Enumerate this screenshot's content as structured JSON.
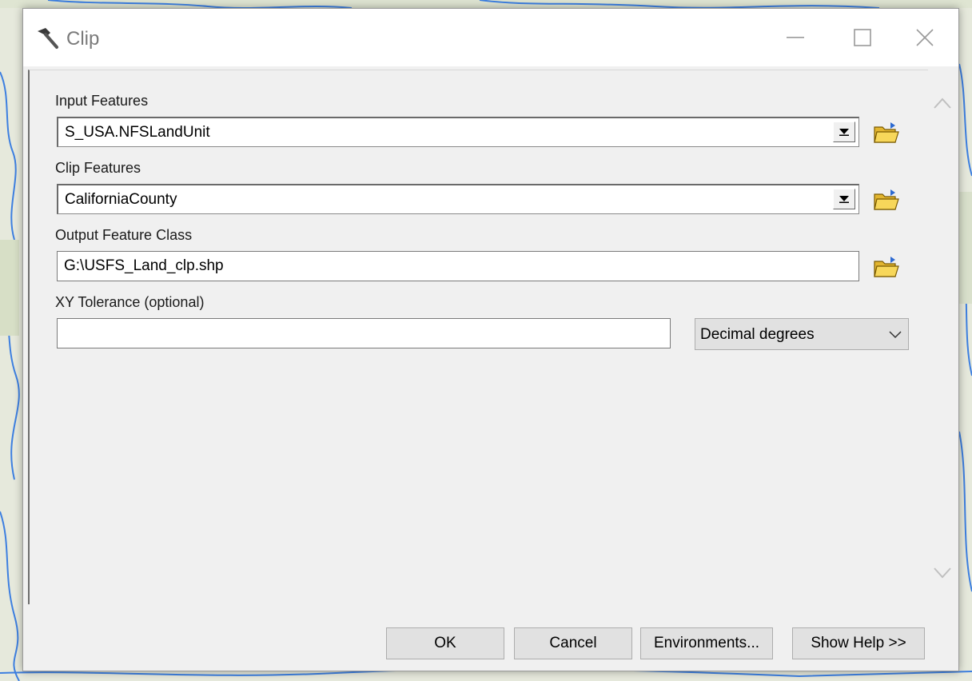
{
  "window": {
    "title": "Clip"
  },
  "form": {
    "input_features": {
      "label": "Input Features",
      "value": "S_USA.NFSLandUnit"
    },
    "clip_features": {
      "label": "Clip Features",
      "value": "CaliforniaCounty"
    },
    "output_feature_class": {
      "label": "Output Feature Class",
      "value": "G:\\USFS_Land_clp.shp"
    },
    "xy_tolerance": {
      "label": "XY Tolerance (optional)",
      "value": "",
      "units": "Decimal degrees"
    }
  },
  "buttons": {
    "ok": "OK",
    "cancel": "Cancel",
    "environments": "Environments...",
    "show_help": "Show Help >>"
  },
  "icons": {
    "title": "hammer-icon",
    "browse": "open-folder-icon",
    "dropdown": "triangle-down-icon",
    "minimize": "minimize-icon",
    "maximize": "maximize-icon",
    "close": "close-icon"
  },
  "colors": {
    "dialog_bg": "#f0f0f0",
    "titlebar_bg": "#ffffff",
    "button_bg": "#e1e1e1",
    "folder_yellow": "#f5d24a"
  }
}
